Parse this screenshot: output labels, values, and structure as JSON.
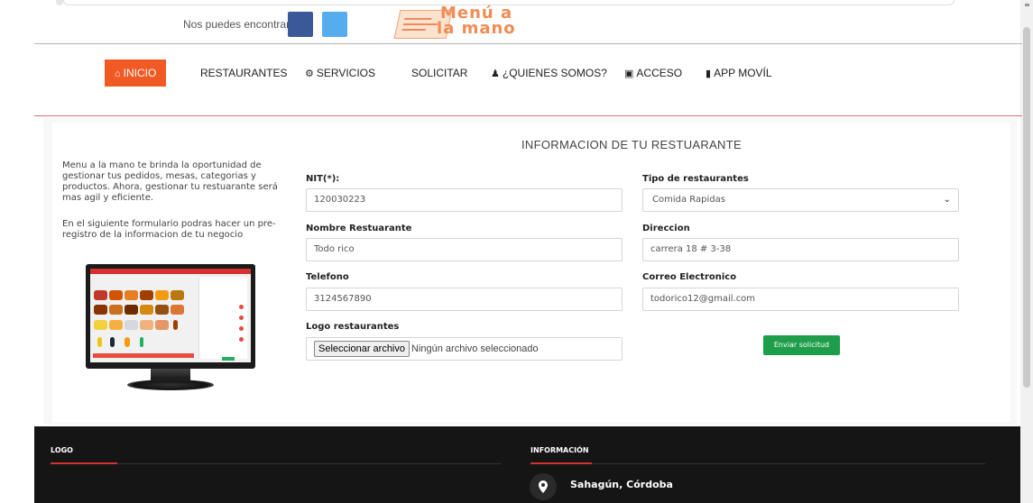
{
  "header": {
    "find_us_label": "Nos puedes encontrar:",
    "social": [
      "facebook-icon",
      "twitter-icon"
    ],
    "logo_line1": "Menú a",
    "logo_line2": "la mano"
  },
  "nav": {
    "items": [
      {
        "label": "INICIO",
        "icon": "home-icon"
      },
      {
        "label": "RESTAURANTES"
      },
      {
        "label": "SERVICIOS",
        "icon": "gears-icon"
      },
      {
        "label": "SOLICITAR"
      },
      {
        "label": "¿QUIENES SOMOS?",
        "icon": "users-icon"
      },
      {
        "label": "ACCESO",
        "icon": "lock-icon"
      },
      {
        "label": "APP MOVÍL",
        "icon": "mobile-icon"
      }
    ]
  },
  "intro": {
    "paragraph1": "Menu a la mano te brinda la oportunidad de gestionar tus pedidos, mesas, categorias y productos. Ahora, gestionar tu restuarante será mas agil y eficiente.",
    "paragraph2": "En el siguiente formulario podras hacer un pre-registro de la informacion de tu negocio"
  },
  "form": {
    "title": "INFORMACION DE TU RESTUARANTE",
    "nit_label": "NIT(*):",
    "nit_value": "120030223",
    "tipo_label": "Tipo de restaurantes",
    "tipo_value": "Comida Rapidas",
    "nombre_label": "Nombre Restuarante",
    "nombre_value": "Todo rico",
    "direccion_label": "Direccion",
    "direccion_value": "carrera 18 # 3-38",
    "telefono_label": "Telefono",
    "telefono_value": "3124567890",
    "correo_label": "Correo Electronico",
    "correo_value": "todorico12@gmail.com",
    "logo_label": "Logo restaurantes",
    "file_button": "Seleccionar archivo",
    "file_status": "Ningún archivo seleccionado",
    "submit_label": "Enviar solicitud"
  },
  "footer": {
    "logo_heading": "LOGO",
    "info_heading": "INFORMACIÓN",
    "location": "Sahagún, Córdoba"
  },
  "colors": {
    "accent": "#f15a24",
    "submit": "#1e9e4a",
    "footer_bg": "#151515",
    "facebook": "#3b5998",
    "twitter": "#55acee"
  }
}
